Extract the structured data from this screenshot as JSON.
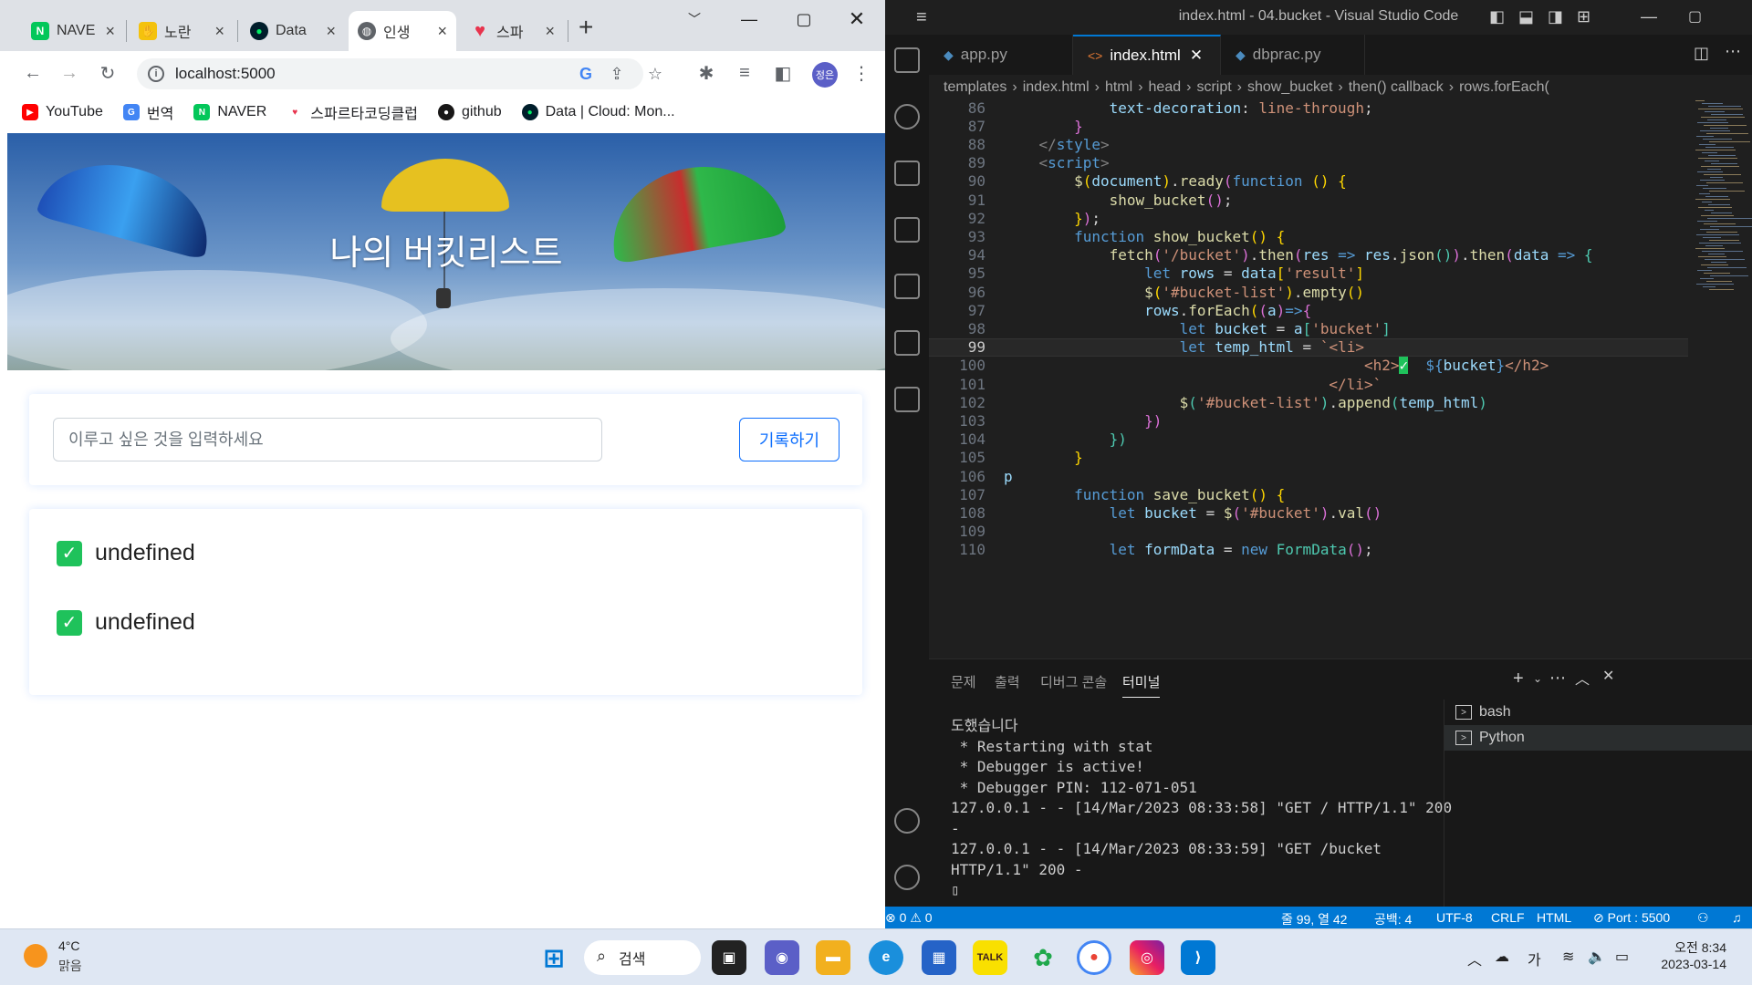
{
  "browser": {
    "tabs": [
      {
        "label": "NAVE",
        "favicon": "naver-icon"
      },
      {
        "label": "노란",
        "favicon": "yellow-hand-icon"
      },
      {
        "label": "Data",
        "favicon": "mongodb-leaf-icon"
      },
      {
        "label": "인생",
        "favicon": "globe-icon",
        "active": true
      },
      {
        "label": "스파",
        "favicon": "sparta-heart-icon"
      }
    ],
    "url": "localhost:5000",
    "profile_label": "정은",
    "bookmarks": [
      "YouTube",
      "번역",
      "NAVER",
      "스파르타코딩클럽",
      "github",
      "Data | Cloud: Mon..."
    ]
  },
  "page": {
    "hero_title": "나의 버킷리스트",
    "input_placeholder": "이루고 싶은 것을 입력하세요",
    "save_label": "기록하기",
    "items": [
      "undefined",
      "undefined"
    ],
    "check_color": "#1fc25b"
  },
  "vscode": {
    "title": "index.html - 04.bucket - Visual Studio Code",
    "tabs": [
      "app.py",
      "index.html",
      "dbprac.py"
    ],
    "breadcrumb": [
      "templates",
      "index.html",
      "html",
      "head",
      "script",
      "show_bucket",
      "then() callback",
      "rows.forEach("
    ],
    "panel_tabs": [
      "문제",
      "출력",
      "디버그 콘솔",
      "터미널"
    ],
    "terminal_lines": [
      "도했습니다",
      " * Restarting with stat",
      " * Debugger is active!",
      " * Debugger PIN: 112-071-051",
      "127.0.0.1 - - [14/Mar/2023 08:33:58] \"GET / HTTP/1.1\" 200 -",
      "127.0.0.1 - - [14/Mar/2023 08:33:59] \"GET /bucket HTTP/1.1\" 200 -"
    ],
    "terminals": [
      "bash",
      "Python"
    ],
    "status": {
      "problems": "⊗ 0 ⚠ 0",
      "cursor": "줄 99, 열 42",
      "spaces": "공백: 4",
      "encoding": "UTF-8",
      "eol": "CRLF",
      "language": "HTML",
      "port": "⊘ Port : 5500"
    }
  },
  "taskbar": {
    "temperature": "4°C",
    "condition": "맑음",
    "search_label": "검색",
    "ime": "가",
    "time": "오전 8:34",
    "date": "2023-03-14"
  }
}
